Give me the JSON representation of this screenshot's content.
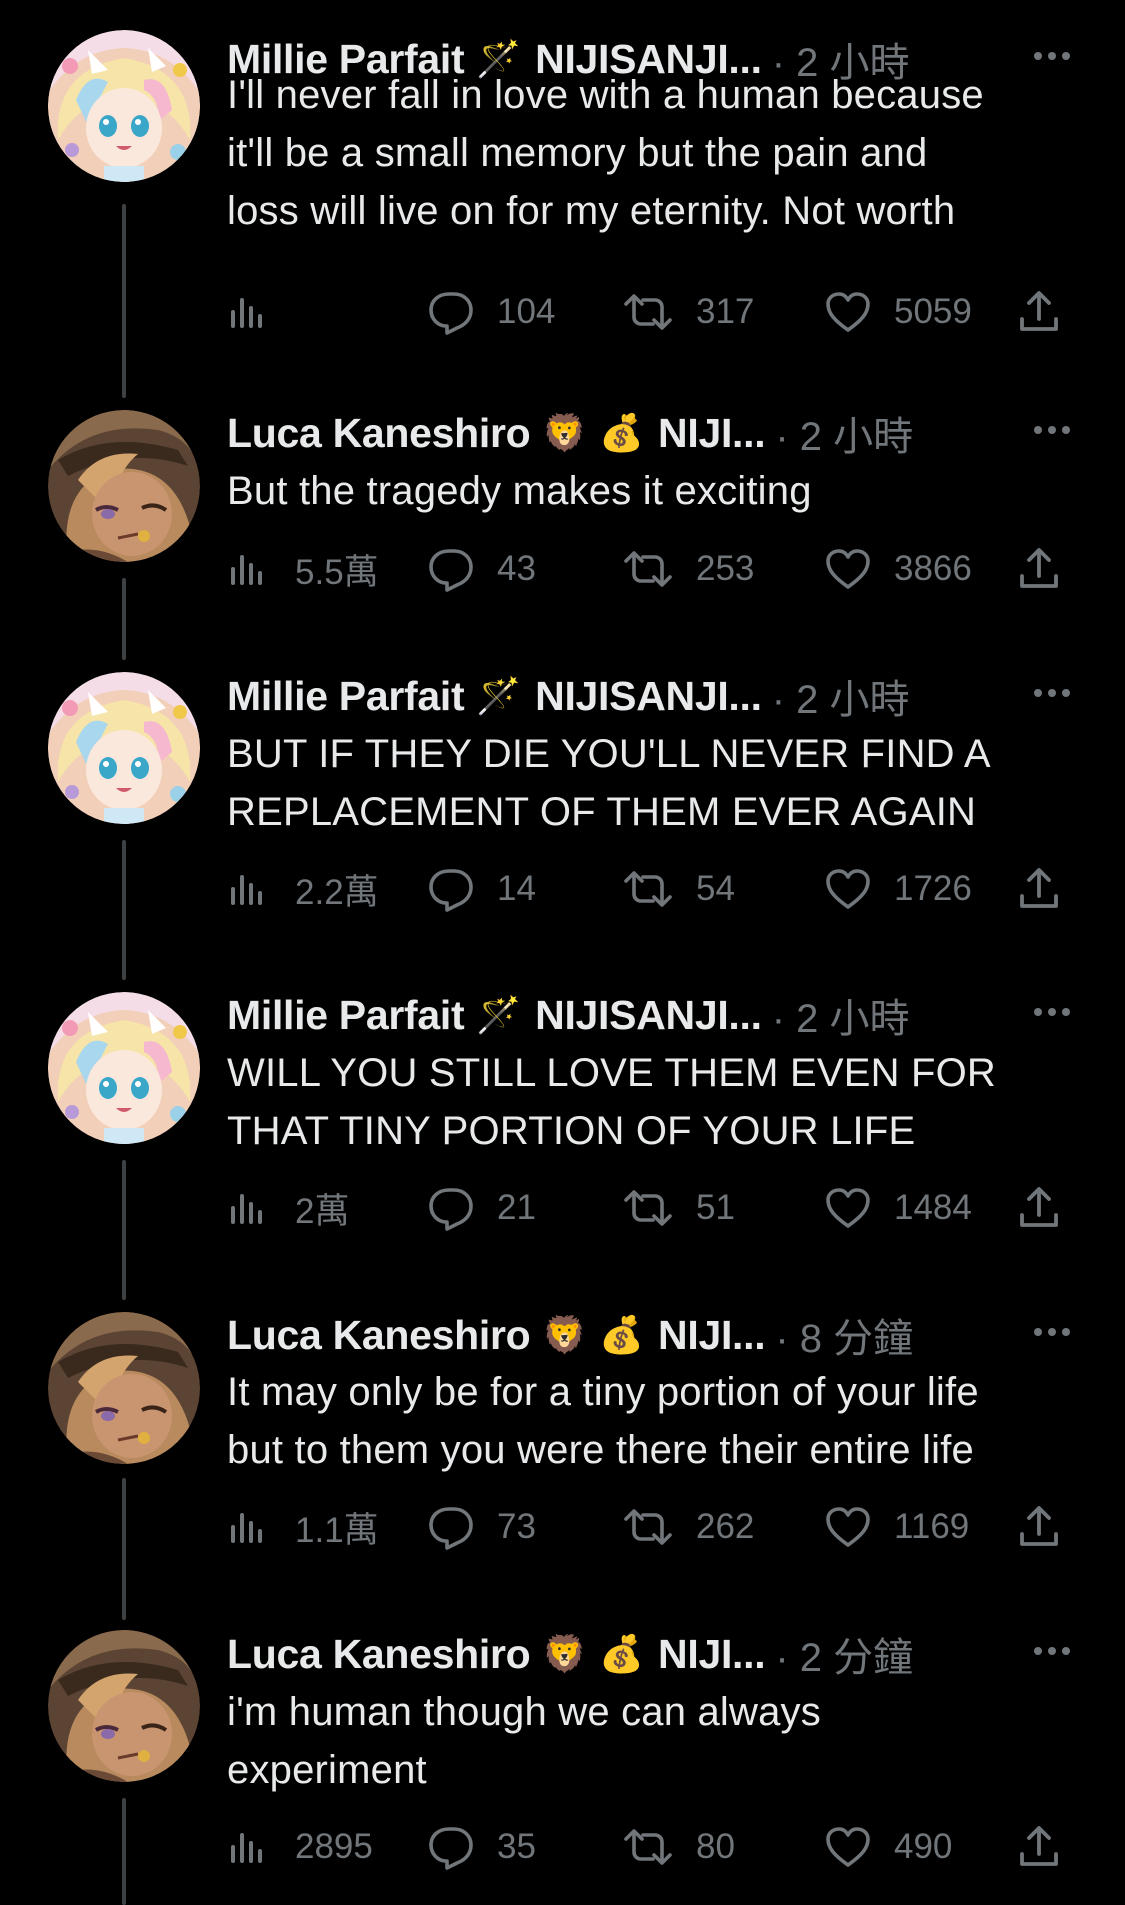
{
  "tweets": [
    {
      "name": "Millie Parfait",
      "emojis": [
        "🪄"
      ],
      "org": "NIJISANJI...",
      "time": "· 2 小時",
      "lines": [
        "I'll never fall in love with a human because",
        "it'll be a small memory but the pain and",
        "loss will live on for my eternity. Not worth"
      ],
      "views": "",
      "replies": "104",
      "retweets": "317",
      "likes": "5059"
    },
    {
      "name": "Luca Kaneshiro",
      "emojis": [
        "🦁",
        "💰"
      ],
      "org": "NIJI...",
      "time": "· 2 小時",
      "lines": [
        "But the tragedy makes it exciting"
      ],
      "views": "5.5萬",
      "replies": "43",
      "retweets": "253",
      "likes": "3866"
    },
    {
      "name": "Millie Parfait",
      "emojis": [
        "🪄"
      ],
      "org": "NIJISANJI...",
      "time": "· 2 小時",
      "lines": [
        "BUT IF THEY DIE YOU'LL NEVER FIND A",
        "REPLACEMENT OF THEM EVER AGAIN"
      ],
      "views": "2.2萬",
      "replies": "14",
      "retweets": "54",
      "likes": "1726"
    },
    {
      "name": "Millie Parfait",
      "emojis": [
        "🪄"
      ],
      "org": "NIJISANJI...",
      "time": "· 2 小時",
      "lines": [
        "WILL YOU STILL LOVE THEM EVEN FOR",
        "THAT TINY PORTION OF YOUR LIFE"
      ],
      "views": "2萬",
      "replies": "21",
      "retweets": "51",
      "likes": "1484"
    },
    {
      "name": "Luca Kaneshiro",
      "emojis": [
        "🦁",
        "💰"
      ],
      "org": "NIJI...",
      "time": "· 8 分鐘",
      "lines": [
        "It may only be for a tiny portion of your life",
        "but to them you were there their entire life"
      ],
      "views": "1.1萬",
      "replies": "73",
      "retweets": "262",
      "likes": "1169"
    },
    {
      "name": "Luca Kaneshiro",
      "emojis": [
        "🦁",
        "💰"
      ],
      "org": "NIJI...",
      "time": "· 2 分鐘",
      "lines": [
        "i'm human though we can always",
        "experiment"
      ],
      "views": "2895",
      "replies": "35",
      "retweets": "80",
      "likes": "490"
    }
  ],
  "colors": {
    "background": "#000000",
    "text": "#e7e9ea",
    "muted": "#71767b",
    "thread_line": "#3e4144"
  },
  "icons": {
    "views": "bar-chart-icon",
    "reply": "speech-bubble-icon",
    "retweet": "retweet-icon",
    "like": "heart-icon",
    "share": "share-icon",
    "more": "more-icon"
  }
}
